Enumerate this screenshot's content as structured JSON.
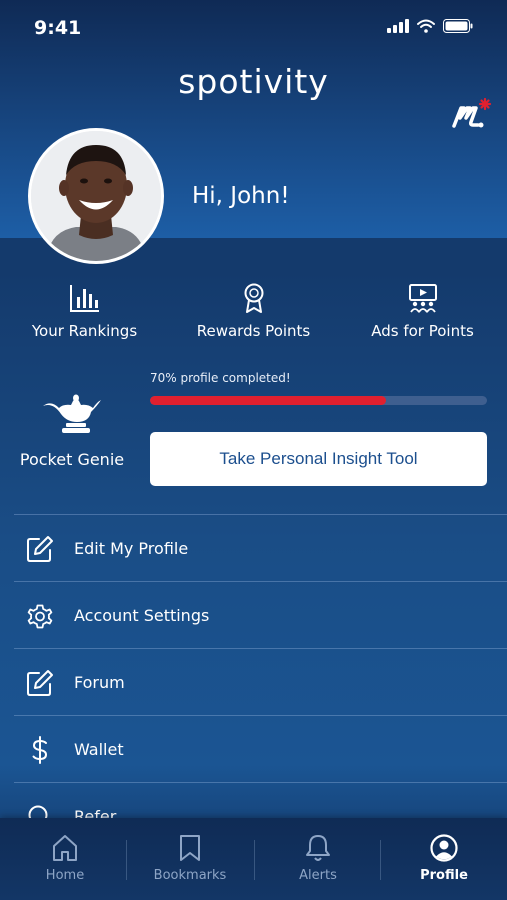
{
  "status_bar": {
    "time": "9:41"
  },
  "brand": {
    "name": "spotivity"
  },
  "profile": {
    "greeting": "Hi, John!"
  },
  "quick_actions": [
    {
      "label": "Your Rankings",
      "icon": "bar-chart-icon"
    },
    {
      "label": "Rewards Points",
      "icon": "award-ribbon-icon"
    },
    {
      "label": "Ads for Points",
      "icon": "video-audience-icon"
    }
  ],
  "genie": {
    "label": "Pocket Genie",
    "icon": "genie-lamp-icon"
  },
  "progress": {
    "label": "70% profile completed!",
    "value": 0.7,
    "color": "#e0202f"
  },
  "insight_button": {
    "label": "Take Personal Insight Tool"
  },
  "menu": [
    {
      "label": "Edit My Profile",
      "icon": "edit-square-icon"
    },
    {
      "label": "Account Settings",
      "icon": "gear-icon"
    },
    {
      "label": "Forum",
      "icon": "edit-square-icon"
    },
    {
      "label": "Wallet",
      "icon": "dollar-icon"
    },
    {
      "label": "Refer",
      "icon": "search-icon"
    }
  ],
  "tabs": [
    {
      "label": "Home",
      "icon": "home-icon"
    },
    {
      "label": "Bookmarks",
      "icon": "bookmark-icon"
    },
    {
      "label": "Alerts",
      "icon": "bell-icon"
    },
    {
      "label": "Profile",
      "icon": "user-circle-icon",
      "active": true
    }
  ],
  "colors": {
    "accent": "#1c4f8e",
    "progress_track": "#3f5f8f",
    "logo_star": "#e0202f"
  }
}
